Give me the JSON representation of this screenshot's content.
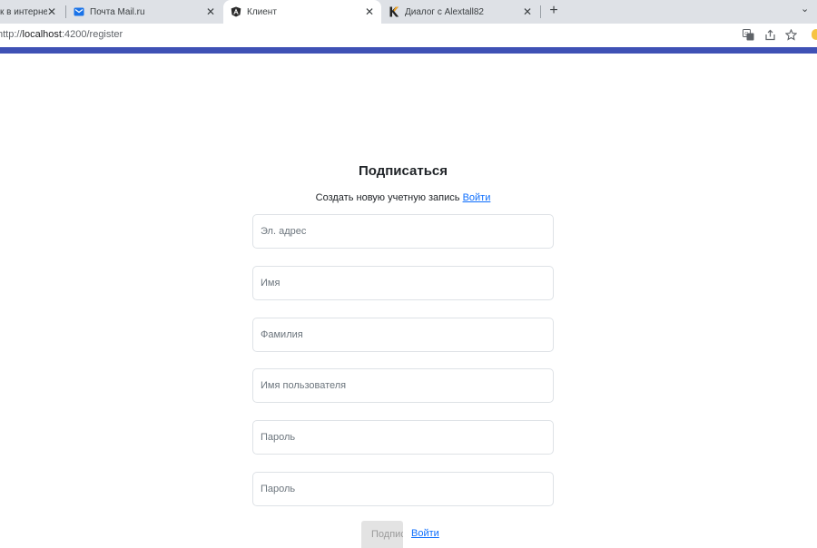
{
  "browser": {
    "tabs": [
      {
        "title": "к в интернет",
        "active": false
      },
      {
        "title": "Почта Mail.ru",
        "active": false
      },
      {
        "title": "Клиент",
        "active": true
      },
      {
        "title": "Диалог с Alextall82",
        "active": false
      }
    ],
    "close_glyph": "✕",
    "new_tab_glyph": "+",
    "tab_menu_glyph": "⌄",
    "url_scheme": "http://",
    "url_host": "localhost",
    "url_path": ":4200/register",
    "icons": [
      "translate-icon",
      "share-icon",
      "star-icon"
    ]
  },
  "colors": {
    "accent": "#3f51b5",
    "link": "#0d6efd"
  },
  "page": {
    "title": "Подписаться",
    "subtitle_text": "Создать новую учетную запись",
    "subtitle_link": "Войти",
    "fields": [
      {
        "placeholder": "Эл. адрес",
        "value": ""
      },
      {
        "placeholder": "Имя",
        "value": ""
      },
      {
        "placeholder": "Фамилия",
        "value": ""
      },
      {
        "placeholder": "Имя пользователя",
        "value": ""
      },
      {
        "placeholder": "Пароль",
        "value": ""
      },
      {
        "placeholder": "Пароль",
        "value": ""
      }
    ],
    "submit_label": "Подписаться",
    "bottom_link": "Войти"
  }
}
